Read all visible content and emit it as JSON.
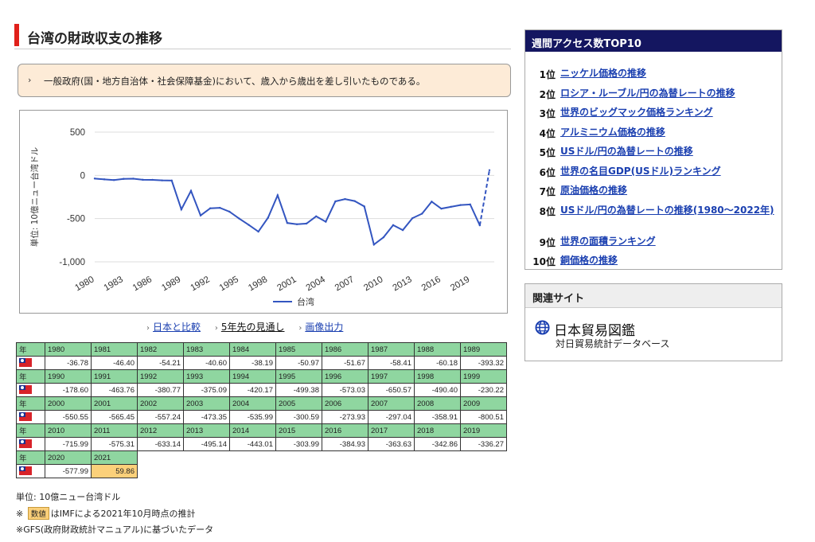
{
  "page_title": "台湾の財政収支の推移",
  "note": "一般政府(国・地方自治体・社会保障基金)において、歳入から歳出を差し引いたものである。",
  "chart_data": {
    "type": "line",
    "title": "",
    "ylabel": "単位: 10億ニュー台湾ドル",
    "xlabel": "",
    "ylim": [
      -1000,
      500
    ],
    "yticks": [
      500,
      0,
      -500,
      -1000
    ],
    "ytick_labels": [
      "500",
      "0",
      "-500",
      "-1,000"
    ],
    "x_tick_labels": [
      "1980",
      "1983",
      "1986",
      "1989",
      "1992",
      "1995",
      "1998",
      "2001",
      "2004",
      "2007",
      "2010",
      "2013",
      "2016",
      "2019"
    ],
    "legend_position": "bottom",
    "grid": true,
    "series": [
      {
        "name": "台湾",
        "color": "#3355c0",
        "x": [
          1980,
          1981,
          1982,
          1983,
          1984,
          1985,
          1986,
          1987,
          1988,
          1989,
          1990,
          1991,
          1992,
          1993,
          1994,
          1995,
          1996,
          1997,
          1998,
          1999,
          2000,
          2001,
          2002,
          2003,
          2004,
          2005,
          2006,
          2007,
          2008,
          2009,
          2010,
          2011,
          2012,
          2013,
          2014,
          2015,
          2016,
          2017,
          2018,
          2019,
          2020,
          2021
        ],
        "values": [
          -36.78,
          -46.4,
          -54.21,
          -40.6,
          -38.19,
          -50.97,
          -51.67,
          -58.41,
          -60.18,
          -393.32,
          -178.6,
          -463.76,
          -380.77,
          -375.09,
          -420.17,
          -499.38,
          -573.03,
          -650.57,
          -490.4,
          -230.22,
          -550.55,
          -565.45,
          -557.24,
          -473.35,
          -535.99,
          -300.59,
          -273.93,
          -297.04,
          -358.91,
          -800.51,
          -715.99,
          -575.31,
          -633.14,
          -495.14,
          -443.01,
          -303.99,
          -384.93,
          -363.63,
          -342.86,
          -336.27,
          -577.99,
          59.86
        ],
        "estimate_from": 2021
      }
    ]
  },
  "links": {
    "compare": "日本と比較",
    "forecast": "5年先の見通し",
    "image": "画像出力"
  },
  "table": {
    "year_label": "年",
    "rows": [
      {
        "years": [
          "1980",
          "1981",
          "1982",
          "1983",
          "1984",
          "1985",
          "1986",
          "1987",
          "1988",
          "1989"
        ],
        "values": [
          "-36.78",
          "-46.40",
          "-54.21",
          "-40.60",
          "-38.19",
          "-50.97",
          "-51.67",
          "-58.41",
          "-60.18",
          "-393.32"
        ]
      },
      {
        "years": [
          "1990",
          "1991",
          "1992",
          "1993",
          "1994",
          "1995",
          "1996",
          "1997",
          "1998",
          "1999"
        ],
        "values": [
          "-178.60",
          "-463.76",
          "-380.77",
          "-375.09",
          "-420.17",
          "-499.38",
          "-573.03",
          "-650.57",
          "-490.40",
          "-230.22"
        ]
      },
      {
        "years": [
          "2000",
          "2001",
          "2002",
          "2003",
          "2004",
          "2005",
          "2006",
          "2007",
          "2008",
          "2009"
        ],
        "values": [
          "-550.55",
          "-565.45",
          "-557.24",
          "-473.35",
          "-535.99",
          "-300.59",
          "-273.93",
          "-297.04",
          "-358.91",
          "-800.51"
        ]
      },
      {
        "years": [
          "2010",
          "2011",
          "2012",
          "2013",
          "2014",
          "2015",
          "2016",
          "2017",
          "2018",
          "2019"
        ],
        "values": [
          "-715.99",
          "-575.31",
          "-633.14",
          "-495.14",
          "-443.01",
          "-303.99",
          "-384.93",
          "-363.63",
          "-342.86",
          "-336.27"
        ]
      },
      {
        "years": [
          "2020",
          "2021"
        ],
        "values": [
          "-577.99",
          "59.86"
        ],
        "estimated": [
          false,
          true
        ]
      }
    ]
  },
  "footnotes": {
    "unit": "単位: 10億ニュー台湾ドル",
    "estimate_prefix": "※",
    "estimate_badge": "数値",
    "estimate_suffix": "はIMFによる2021年10月時点の推計",
    "gfs": "※GFS(政府財政統計マニュアル)に基づいたデータ"
  },
  "sidebar": {
    "top10_title": "週間アクセス数TOP10",
    "top10": [
      {
        "rank": "1位",
        "label": "ニッケル価格の推移"
      },
      {
        "rank": "2位",
        "label": "ロシア・ルーブル/円の為替レートの推移"
      },
      {
        "rank": "3位",
        "label": "世界のビッグマック価格ランキング"
      },
      {
        "rank": "4位",
        "label": "アルミニウム価格の推移"
      },
      {
        "rank": "5位",
        "label": "USドル/円の為替レートの推移"
      },
      {
        "rank": "6位",
        "label": "世界の名目GDP(USドル)ランキング"
      },
      {
        "rank": "7位",
        "label": "原油価格の推移"
      },
      {
        "rank": "8位",
        "label": "USドル/円の為替レートの推移(1980～2022年)"
      },
      {
        "rank": "9位",
        "label": "世界の面積ランキング"
      },
      {
        "rank": "10位",
        "label": "銅価格の推移"
      }
    ],
    "related_title": "関連サイト",
    "related_site": "日本貿易図鑑",
    "related_sub": "対日貿易統計データベース",
    "globe_icon": "globe-icon"
  }
}
